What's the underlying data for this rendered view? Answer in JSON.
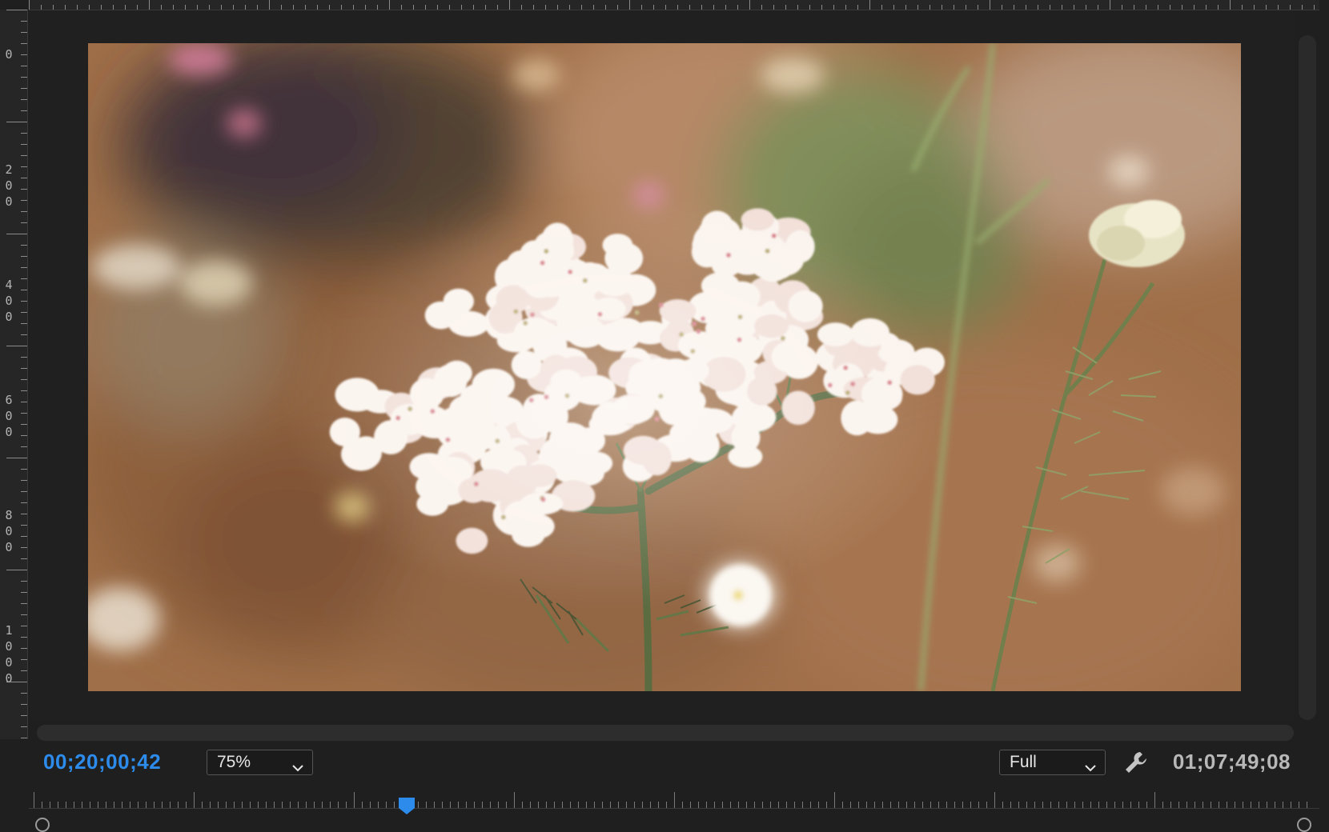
{
  "ruler_left": {
    "labels": [
      "0",
      "200",
      "400",
      "600",
      "800",
      "1000"
    ]
  },
  "bottom_bar": {
    "current_timecode": "00;20;00;42",
    "zoom_level": "75%",
    "quality": "Full",
    "duration_timecode": "01;07;49;08"
  },
  "colors": {
    "accent": "#2d8ceb",
    "panel_bg": "#1f1f1f",
    "text_secondary": "#b8b8b8"
  },
  "icons": {
    "settings": "wrench-icon",
    "playhead": "playhead-marker-icon",
    "dropdown": "chevron-down-icon"
  }
}
